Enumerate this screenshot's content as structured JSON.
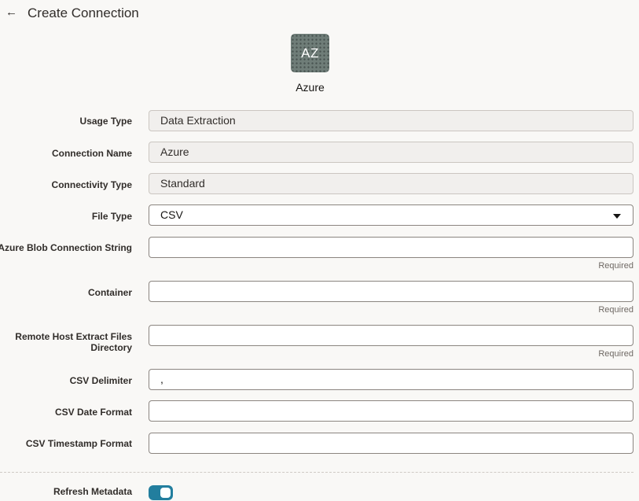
{
  "header": {
    "back_icon": "arrow-left-icon",
    "title": "Create Connection"
  },
  "connection": {
    "icon_text": "AZ",
    "name": "Azure"
  },
  "form": {
    "usage_type": {
      "label": "Usage Type",
      "value": "Data Extraction"
    },
    "connection_name": {
      "label": "Connection Name",
      "value": "Azure"
    },
    "connectivity_type": {
      "label": "Connectivity Type",
      "value": "Standard"
    },
    "file_type": {
      "label": "File Type",
      "value": "CSV"
    },
    "blob_connection_string": {
      "label": "Azure Blob Connection String",
      "value": "",
      "hint": "Required"
    },
    "container": {
      "label": "Container",
      "value": "",
      "hint": "Required"
    },
    "remote_host_dir": {
      "label": "Remote Host Extract Files Directory",
      "value": "",
      "hint": "Required"
    },
    "csv_delimiter": {
      "label": "CSV Delimiter",
      "value": ","
    },
    "csv_date_format": {
      "label": "CSV Date Format",
      "value": ""
    },
    "csv_timestamp_format": {
      "label": "CSV Timestamp Format",
      "value": ""
    },
    "refresh_metadata": {
      "label": "Refresh Metadata",
      "enabled": true
    }
  },
  "colors": {
    "toggle_on": "#227e9e",
    "icon_bg": "#6f7d78",
    "page_bg": "#f9f8f6"
  }
}
